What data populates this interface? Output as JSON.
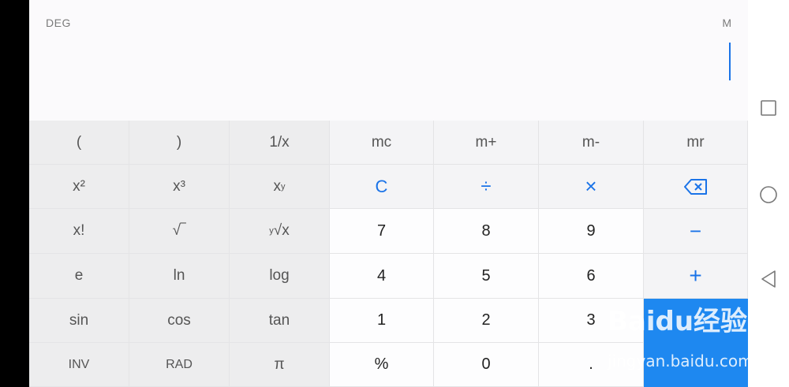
{
  "display": {
    "angle_mode": "DEG",
    "memory_indicator": "M",
    "value": ""
  },
  "keys": {
    "open_paren": "(",
    "close_paren": ")",
    "reciprocal": "1/x",
    "mc": "mc",
    "m_plus": "m+",
    "m_minus": "m-",
    "mr": "mr",
    "square": "x²",
    "cube": "x³",
    "power_base": "x",
    "power_exp": "y",
    "clear": "C",
    "divide": "÷",
    "multiply": "×",
    "factorial": "x!",
    "sqrt": "√‾",
    "root_index": "y",
    "root_radicand": "√x",
    "seven": "7",
    "eight": "8",
    "nine": "9",
    "minus": "−",
    "e": "e",
    "ln": "ln",
    "log": "log",
    "four": "4",
    "five": "5",
    "six": "6",
    "plus": "+",
    "sin": "sin",
    "cos": "cos",
    "tan": "tan",
    "one": "1",
    "two": "2",
    "three": "3",
    "inv": "INV",
    "rad": "RAD",
    "pi": "π",
    "percent": "%",
    "zero": "0",
    "decimal": "."
  },
  "watermark": {
    "logo": "Baidu经验",
    "url": "jingyan.baidu.com"
  },
  "colors": {
    "accent": "#1a73e8",
    "equals_bg": "#1e88f0",
    "sci_bg": "#ededee"
  }
}
